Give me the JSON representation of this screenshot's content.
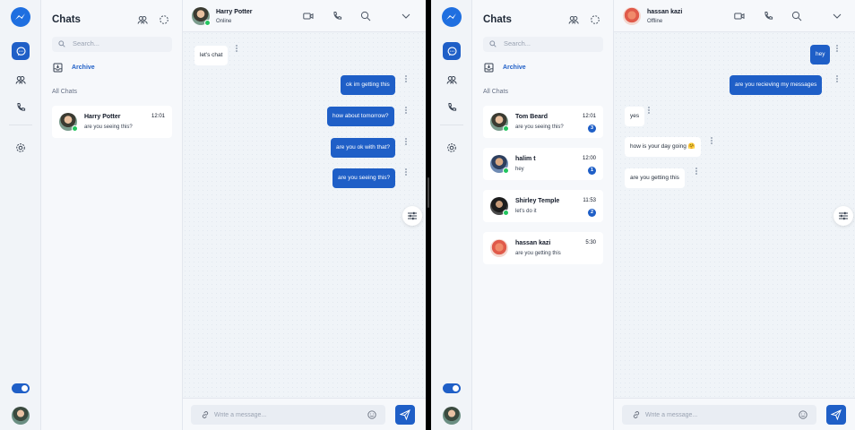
{
  "colors": {
    "accent": "#1f5fc7",
    "online": "#22c55e",
    "rail_bg": "#f1f4f8",
    "conv_bg": "#f0f4f8"
  },
  "left": {
    "list": {
      "title": "Chats",
      "search_placeholder": "Search...",
      "archive_label": "Archive",
      "section_label": "All Chats",
      "chats": [
        {
          "name": "Harry Potter",
          "preview": "are you seeing this?",
          "time": "12:01",
          "online": true
        }
      ]
    },
    "conversation": {
      "name": "Harry Potter",
      "status": "Online",
      "messages": [
        {
          "dir": "in",
          "text": "let's chat"
        },
        {
          "dir": "out",
          "text": "ok im getting this"
        },
        {
          "dir": "out",
          "text": "how about tomorrow?"
        },
        {
          "dir": "out",
          "text": "are you ok with that?"
        },
        {
          "dir": "out",
          "text": "are you seeing this?"
        }
      ],
      "composer_placeholder": "Write a message..."
    }
  },
  "right": {
    "list": {
      "title": "Chats",
      "search_placeholder": "Search...",
      "archive_label": "Archive",
      "section_label": "All Chats",
      "chats": [
        {
          "name": "Tom Beard",
          "preview": "are you seeing this?",
          "time": "12:01",
          "badge": "3",
          "online": true
        },
        {
          "name": "halim t",
          "preview": "hey",
          "time": "12:00",
          "badge": "1",
          "online": true
        },
        {
          "name": "Shirley Temple",
          "preview": "let's do it",
          "time": "11:53",
          "badge": "2",
          "online": true
        },
        {
          "name": "hassan kazi",
          "preview": "are you getting this",
          "time": "5:30",
          "online": false
        }
      ]
    },
    "conversation": {
      "name": "hassan kazi",
      "status": "Offline",
      "messages": [
        {
          "dir": "out",
          "text": "hey"
        },
        {
          "dir": "out",
          "text": "are you recieving my messages"
        },
        {
          "dir": "in",
          "text": "yes"
        },
        {
          "dir": "in",
          "text": "how is your day going 🤗"
        },
        {
          "dir": "in",
          "text": "are you getting this"
        }
      ],
      "composer_placeholder": "Write a message..."
    }
  }
}
